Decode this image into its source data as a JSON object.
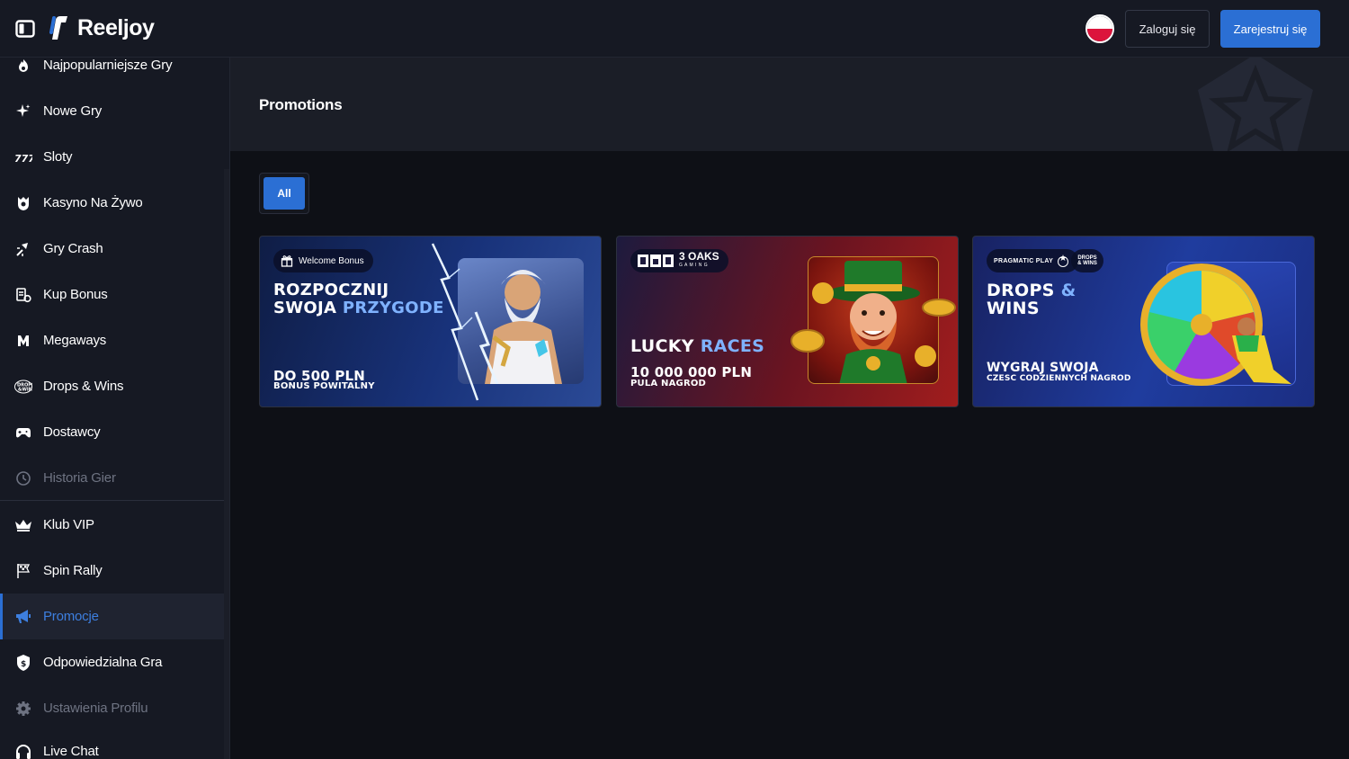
{
  "app": {
    "brand": "Reeljoy"
  },
  "topbar": {
    "login_label": "Zaloguj się",
    "register_label": "Zarejestruj się",
    "language": "pl-flag"
  },
  "sidebar": {
    "items": [
      {
        "label": "Najpopularniejsze Gry",
        "icon": "fire-icon"
      },
      {
        "label": "Nowe Gry",
        "icon": "sparkle-icon"
      },
      {
        "label": "Sloty",
        "icon": "slots-777-icon"
      },
      {
        "label": "Kasyno Na Żywo",
        "icon": "live-casino-icon"
      },
      {
        "label": "Gry Crash",
        "icon": "crash-icon"
      },
      {
        "label": "Kup Bonus",
        "icon": "buy-bonus-icon"
      },
      {
        "label": "Megaways",
        "icon": "megaways-icon"
      },
      {
        "label": "Drops & Wins",
        "icon": "drops-wins-icon"
      },
      {
        "label": "Dostawcy",
        "icon": "gamepad-icon"
      },
      {
        "label": "Historia Gier",
        "icon": "history-icon"
      },
      {
        "label": "Klub VIP",
        "icon": "crown-icon"
      },
      {
        "label": "Spin Rally",
        "icon": "flag-icon"
      },
      {
        "label": "Promocje",
        "icon": "megaphone-icon"
      },
      {
        "label": "Odpowiedzialna Gra",
        "icon": "shield-dollar-icon"
      },
      {
        "label": "Ustawienia Profilu",
        "icon": "gear-icon"
      },
      {
        "label": "Live Chat",
        "icon": "headset-icon"
      }
    ]
  },
  "main": {
    "title": "Promotions",
    "filter_all": "All",
    "cards": [
      {
        "badge": "Welcome Bonus",
        "headline_1": "ROZPOCZNIJ",
        "headline_2a": "SWOJA ",
        "headline_2b": "PRZYGODE",
        "line_1": "DO 500 PLN",
        "line_2": "BONUS POWITALNY"
      },
      {
        "badge_logo": "3 OAKS",
        "badge_sub": "G A M I N G",
        "headline_a": "LUCKY ",
        "headline_b": "RACES",
        "line_1": "10 000 000 PLN",
        "line_2": "PULA NAGROD"
      },
      {
        "badge": "PRAGMATIC PLAY",
        "badge_2": "DROPS & WINS",
        "headline_1a": "DROPS ",
        "headline_1b": "&",
        "headline_2": "WINS",
        "line_1": "WYGRAJ SWOJA",
        "line_2": "CZESC CODZIENNYCH NAGROD"
      }
    ]
  },
  "colors": {
    "accent": "#2b6fd4",
    "bg": "#0e1016",
    "sidebar": "#161923"
  }
}
